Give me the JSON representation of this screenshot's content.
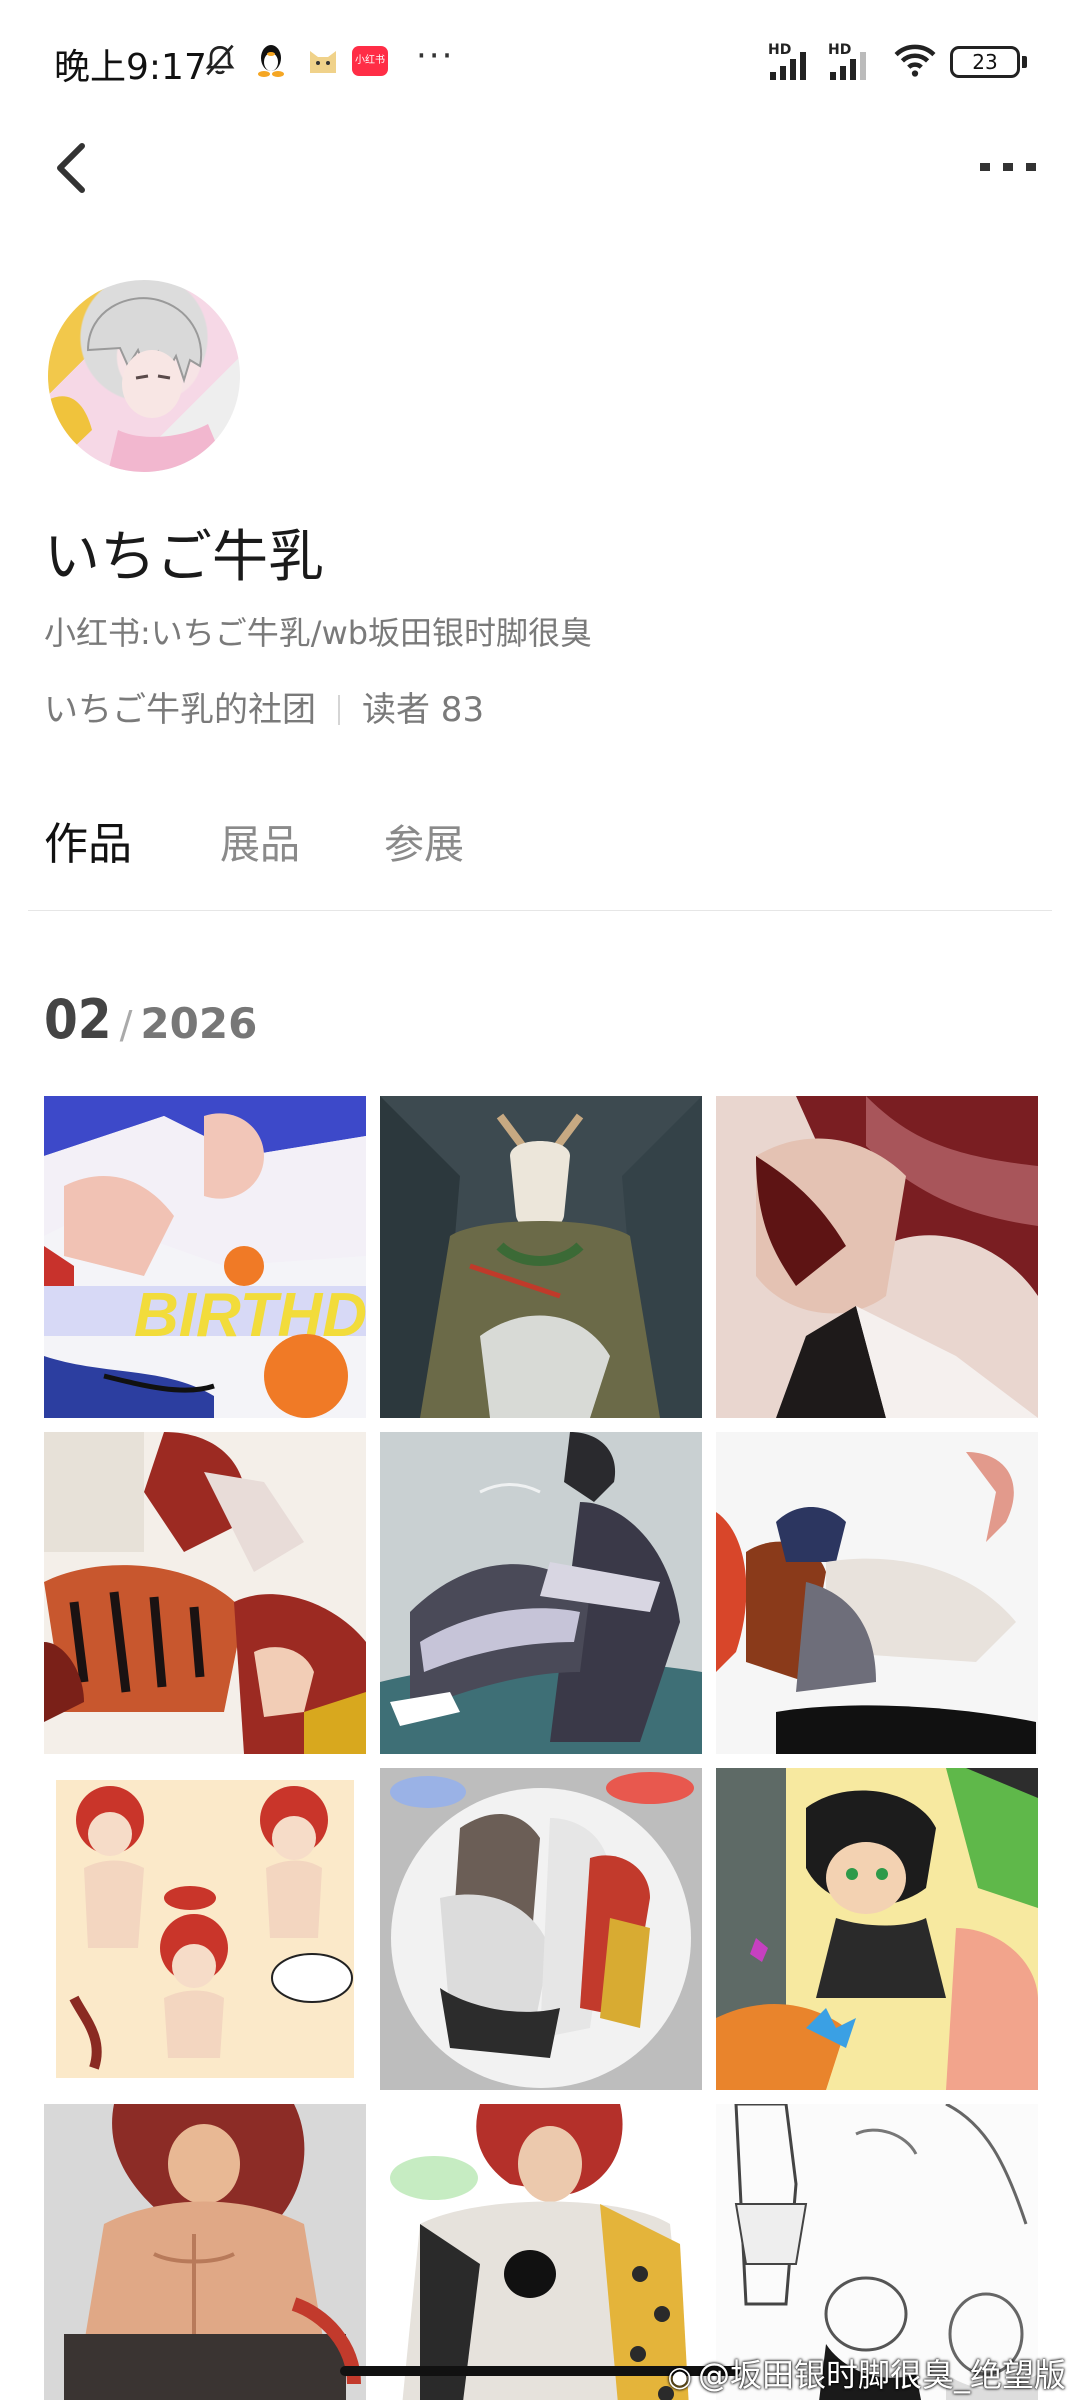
{
  "status_bar": {
    "time": "晚上9:17",
    "app_badge": "小红书",
    "more": "···",
    "hd1": "HD",
    "hd2": "HD",
    "battery": "23"
  },
  "nav": {
    "back_icon": "chevron-left-icon",
    "more_icon": "more-horizontal-icon"
  },
  "profile": {
    "name": "いちご牛乳",
    "description": "小红书:いちご牛乳/wb坂田银时脚很臭",
    "club": "いちご牛乳的社团",
    "readers": "读者 83"
  },
  "tabs": [
    {
      "label": "作品",
      "active": true
    },
    {
      "label": "展品",
      "active": false
    },
    {
      "label": "参展",
      "active": false
    }
  ],
  "section": {
    "month": "02",
    "separator": "/",
    "year": "2026"
  },
  "gallery": {
    "tiles": [
      {
        "name": "artwork-birthday",
        "caption": "BIRTHDAY"
      },
      {
        "name": "artwork-goat",
        "caption": ""
      },
      {
        "name": "artwork-red-hair",
        "caption": ""
      },
      {
        "name": "artwork-tiger",
        "caption": ""
      },
      {
        "name": "artwork-kimono",
        "caption": ""
      },
      {
        "name": "artwork-kneeling",
        "caption": ""
      },
      {
        "name": "artwork-chibi",
        "caption": ""
      },
      {
        "name": "artwork-circle",
        "caption": ""
      },
      {
        "name": "artwork-cat-boy",
        "caption": ""
      },
      {
        "name": "artwork-muscle",
        "caption": ""
      },
      {
        "name": "artwork-leopard",
        "caption": ""
      },
      {
        "name": "artwork-sketch",
        "caption": ""
      }
    ]
  },
  "watermark": "@坂田银时脚很臭_绝望版"
}
